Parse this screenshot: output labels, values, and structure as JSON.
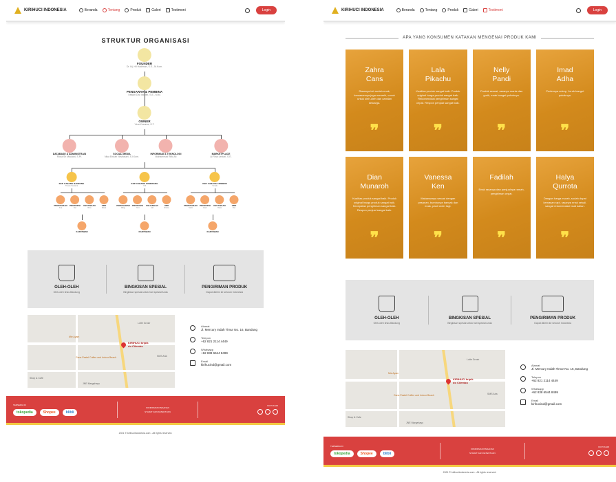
{
  "brand": "KIRIHUCI INDONESIA",
  "nav": {
    "items": [
      "Beranda",
      "Tentang",
      "Produk",
      "Galeri",
      "Testimoni"
    ],
    "login": "Login"
  },
  "org": {
    "title": "STRUKTUR ORGANISASI",
    "founder": {
      "role": "FOUNDER",
      "name": "Dr. Hj. Hil Hadiman, S.E., M.Kom."
    },
    "pengarah": {
      "role": "PENGARAH & PEMBINA",
      "name": "Irawan Dwi Irawan, S.E., M.M."
    },
    "owner": {
      "role": "OWNER",
      "name": "Vina Kesuma, S.T."
    },
    "divisions": [
      {
        "role": "DATABASE & ADMINISTRASI",
        "name": "Rosa Sri Maulani, S.Pt."
      },
      {
        "role": "SOCIAL MEDIA",
        "name": "Nisa Endah Novitasari, S.I.Kom."
      },
      {
        "role": "INFORMASI & TEKNOLOGI",
        "name": "Muhammad Rifki Ali"
      },
      {
        "role": "MARKETPLACE",
        "name": "Ai Rina Lestari, S.E."
      }
    ],
    "branches": [
      {
        "role": "KEP. CABANG BANDUNG",
        "name": "Tresna Suwarna"
      },
      {
        "role": "KEP. CABANG SUMEDANG",
        "name": "Yuli"
      },
      {
        "role": "KEP. CABANG CIREBON",
        "name": "Yunida"
      }
    ],
    "staff_roles": [
      "PEMASARAN",
      "PRODUKSI",
      "KEUANGAN",
      "HRD"
    ],
    "staff_names": [
      [
        "Ana",
        "Nur",
        "Rina",
        "Wasa"
      ],
      [
        "Rifqy",
        "Yoni",
        "Adi",
        "Risma"
      ],
      [
        "Santi",
        "Deni",
        "Reka",
        "Dwi"
      ]
    ],
    "karyawan": "KARYAWAN"
  },
  "services": [
    {
      "title": "OLEH-OLEH",
      "sub": "Oleh-oleh khas Bandung"
    },
    {
      "title": "BINGKISAN SPESIAL",
      "sub": "Bingkisan spesial untuk hari spesial Anda"
    },
    {
      "title": "PENGIRIMAN PRODUK",
      "sub": "Dapat dikirim ke seluruh Indonesia"
    }
  ],
  "map": {
    "pin_label": "KIRIHUCI kripik\ndo Cilembu",
    "labels": [
      "Lotte Grosir",
      "Mie Ayam",
      "Gans Pastel Coffee and Indoor Beach",
      "Shop & Cafe",
      "JNE Margahayu",
      "SMS Aria"
    ]
  },
  "contact": [
    {
      "key": "Alamat",
      "value": "Jl. Mercury Indah Timur No. 16, Bandung"
    },
    {
      "key": "Telepon",
      "value": "+62 821 2114 4449"
    },
    {
      "key": "Whatsapp",
      "value": "+62 838 6544 8499"
    },
    {
      "key": "Email",
      "value": "kirihucind@gmail.com"
    }
  ],
  "footer": {
    "tersedia": "TERSEDIA DI",
    "marketplaces": [
      "tokopedia",
      "Shopee",
      "blibli"
    ],
    "links": [
      "KONFIRMASI PESANAN",
      "SYARAT DAN KETENTUAN"
    ],
    "ikuti": "IKUTI KAMI",
    "copyright": "2021 © kirihuciindonesia.com - All rights reserved."
  },
  "testimonials": {
    "heading": "APA YANG KONSUMEN KATAKAN MENGENAI PRODUK KAMI",
    "cards": [
      {
        "name": "Zahra\nCans",
        "text": "Rasanya tuh sudah enak, kemasannya juga menarik, cocok untuk oleh-oleh dan camilan keluarga."
      },
      {
        "name": "Lala\nPikachu",
        "text": "Kualitas produk sangat baik. Produk original harga produk sangat baik. Rekomendasi pengiriman sangat cepat. Respon penjual sangat baik."
      },
      {
        "name": "Nelly\nPandi",
        "text": "Produk sesuai, rasanya manis dan gurih, enak banget pokoknya."
      },
      {
        "name": "Imad\nAdha",
        "text": "Pedesnya cukup, Jeruk banget pokoknya."
      },
      {
        "name": "Dian\nMunaroh",
        "text": "Kualitas produk sangat baik. Produk original harga produk sangat baik. Kecepatan pengiriman sangat baik. Respon penjual sangat baik."
      },
      {
        "name": "Vanessa\nKen",
        "text": "Makanannya sesuai dengan pesanan, bumbunya banyak dan enak, pasti order lagi."
      },
      {
        "name": "Fadilah",
        "text": "Enak rasanya dan penjualnya ramah, pengiriman cepat."
      },
      {
        "name": "Halya\nQurrota",
        "text": "Dengan harga murah, sudah dapat kemasan rapi, rasanya enak sekali, sangat rekomendasi buat kalian."
      }
    ]
  }
}
